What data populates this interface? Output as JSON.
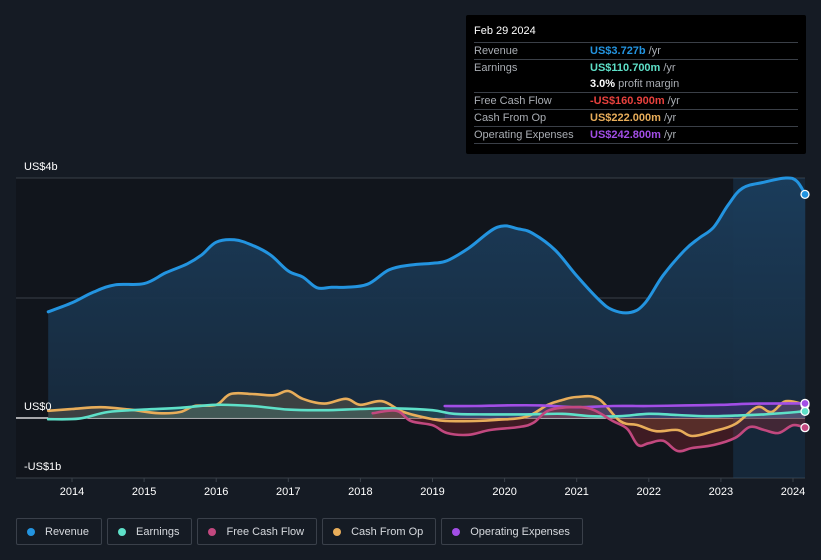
{
  "tooltip": {
    "date": "Feb 29 2024",
    "rows": [
      {
        "label": "Revenue",
        "value": "US$3.727b",
        "unit": "/yr",
        "color": "#2394e0"
      },
      {
        "label": "Earnings",
        "value": "US$110.700m",
        "unit": "/yr",
        "color": "#5ee0c8"
      },
      {
        "label": "",
        "value": "3.0%",
        "unit": "profit margin",
        "color": "#ffffff"
      },
      {
        "label": "Free Cash Flow",
        "value": "-US$160.900m",
        "unit": "/yr",
        "color": "#e8413d"
      },
      {
        "label": "Cash From Op",
        "value": "US$222.000m",
        "unit": "/yr",
        "color": "#e8ad5a"
      },
      {
        "label": "Operating Expenses",
        "value": "US$242.800m",
        "unit": "/yr",
        "color": "#a24ee6"
      }
    ]
  },
  "legend": [
    {
      "label": "Revenue",
      "color": "#2394e0"
    },
    {
      "label": "Earnings",
      "color": "#5ee0c8"
    },
    {
      "label": "Free Cash Flow",
      "color": "#c2487f"
    },
    {
      "label": "Cash From Op",
      "color": "#e8ad5a"
    },
    {
      "label": "Operating Expenses",
      "color": "#a24ee6"
    }
  ],
  "chart_data": {
    "type": "area",
    "title": "",
    "xlabel": "",
    "ylabel": "",
    "y_tick_labels": [
      "US$4b",
      "US$0",
      "-US$1b"
    ],
    "y_ticks": [
      4,
      0,
      -1
    ],
    "ylim": [
      -1,
      4
    ],
    "xlim": [
      2013.67,
      2024.17
    ],
    "x_tick_labels": [
      "2014",
      "2015",
      "2016",
      "2017",
      "2018",
      "2019",
      "2020",
      "2021",
      "2022",
      "2023",
      "2024"
    ],
    "x_ticks": [
      2014,
      2015,
      2016,
      2017,
      2018,
      2019,
      2020,
      2021,
      2022,
      2023,
      2024
    ],
    "units": "US$ billions",
    "grid": true,
    "highlight_start": 2023.17,
    "series": [
      {
        "name": "Revenue",
        "color": "#2394e0",
        "x": [
          2013.67,
          2014.0,
          2014.3,
          2014.6,
          2015.0,
          2015.3,
          2015.6,
          2015.8,
          2016.0,
          2016.25,
          2016.5,
          2016.75,
          2017.0,
          2017.2,
          2017.4,
          2017.6,
          2017.8,
          2018.1,
          2018.4,
          2018.7,
          2019.0,
          2019.2,
          2019.5,
          2019.9,
          2020.2,
          2020.4,
          2020.7,
          2021.0,
          2021.3,
          2021.5,
          2021.75,
          2021.95,
          2022.2,
          2022.5,
          2022.7,
          2022.9,
          2023.1,
          2023.3,
          2023.6,
          2023.9,
          2024.05,
          2024.17
        ],
        "values": [
          1.77,
          1.92,
          2.1,
          2.22,
          2.24,
          2.42,
          2.57,
          2.72,
          2.93,
          2.97,
          2.88,
          2.72,
          2.45,
          2.35,
          2.17,
          2.18,
          2.18,
          2.23,
          2.47,
          2.55,
          2.58,
          2.62,
          2.83,
          3.18,
          3.15,
          3.07,
          2.8,
          2.37,
          1.98,
          1.8,
          1.76,
          1.92,
          2.38,
          2.8,
          3.0,
          3.18,
          3.55,
          3.83,
          3.93,
          4.0,
          3.95,
          3.727
        ]
      },
      {
        "name": "Earnings",
        "color": "#5ee0c8",
        "x": [
          2013.67,
          2014.1,
          2014.5,
          2015.0,
          2015.5,
          2016.0,
          2016.5,
          2017.0,
          2017.5,
          2018.0,
          2018.5,
          2019.0,
          2019.3,
          2019.8,
          2020.3,
          2020.8,
          2021.2,
          2021.6,
          2022.0,
          2022.4,
          2022.8,
          2023.2,
          2023.6,
          2024.17
        ],
        "values": [
          -0.02,
          -0.01,
          0.1,
          0.14,
          0.17,
          0.22,
          0.2,
          0.14,
          0.13,
          0.15,
          0.16,
          0.13,
          0.07,
          0.06,
          0.06,
          0.07,
          0.03,
          0.03,
          0.07,
          0.05,
          0.03,
          0.04,
          0.06,
          0.111
        ]
      },
      {
        "name": "Free Cash Flow",
        "color": "#c2487f",
        "x": [
          2018.17,
          2018.5,
          2018.7,
          2019.0,
          2019.2,
          2019.5,
          2019.8,
          2020.2,
          2020.4,
          2020.6,
          2020.9,
          2021.2,
          2021.5,
          2021.7,
          2021.85,
          2022.0,
          2022.2,
          2022.4,
          2022.6,
          2022.9,
          2023.2,
          2023.4,
          2023.6,
          2023.8,
          2024.0,
          2024.17
        ],
        "values": [
          0.08,
          0.12,
          -0.05,
          -0.12,
          -0.25,
          -0.28,
          -0.2,
          -0.15,
          -0.08,
          0.12,
          0.18,
          0.15,
          -0.05,
          -0.18,
          -0.45,
          -0.42,
          -0.38,
          -0.55,
          -0.5,
          -0.45,
          -0.33,
          -0.15,
          -0.2,
          -0.25,
          -0.12,
          -0.161
        ]
      },
      {
        "name": "Cash From Op",
        "color": "#e8ad5a",
        "x": [
          2013.67,
          2014.0,
          2014.4,
          2014.8,
          2015.2,
          2015.5,
          2015.7,
          2016.0,
          2016.2,
          2016.5,
          2016.8,
          2017.0,
          2017.2,
          2017.5,
          2017.8,
          2018.0,
          2018.3,
          2018.6,
          2019.0,
          2019.2,
          2019.6,
          2019.9,
          2020.3,
          2020.6,
          2020.8,
          2021.0,
          2021.3,
          2021.6,
          2021.85,
          2022.1,
          2022.4,
          2022.6,
          2022.9,
          2023.2,
          2023.5,
          2023.7,
          2023.9,
          2024.17
        ],
        "values": [
          0.12,
          0.15,
          0.18,
          0.14,
          0.08,
          0.1,
          0.2,
          0.22,
          0.4,
          0.4,
          0.38,
          0.45,
          0.32,
          0.24,
          0.32,
          0.22,
          0.28,
          0.1,
          -0.02,
          -0.05,
          -0.05,
          -0.03,
          0.02,
          0.22,
          0.3,
          0.35,
          0.32,
          -0.05,
          -0.12,
          -0.22,
          -0.2,
          -0.3,
          -0.22,
          -0.1,
          0.18,
          0.1,
          0.28,
          0.222
        ]
      },
      {
        "name": "Operating Expenses",
        "color": "#a24ee6",
        "x": [
          2019.17,
          2019.6,
          2020.0,
          2020.5,
          2021.0,
          2021.5,
          2022.0,
          2022.5,
          2023.0,
          2023.5,
          2024.17
        ],
        "values": [
          0.2,
          0.2,
          0.21,
          0.21,
          0.18,
          0.2,
          0.2,
          0.21,
          0.22,
          0.24,
          0.243
        ]
      }
    ]
  }
}
